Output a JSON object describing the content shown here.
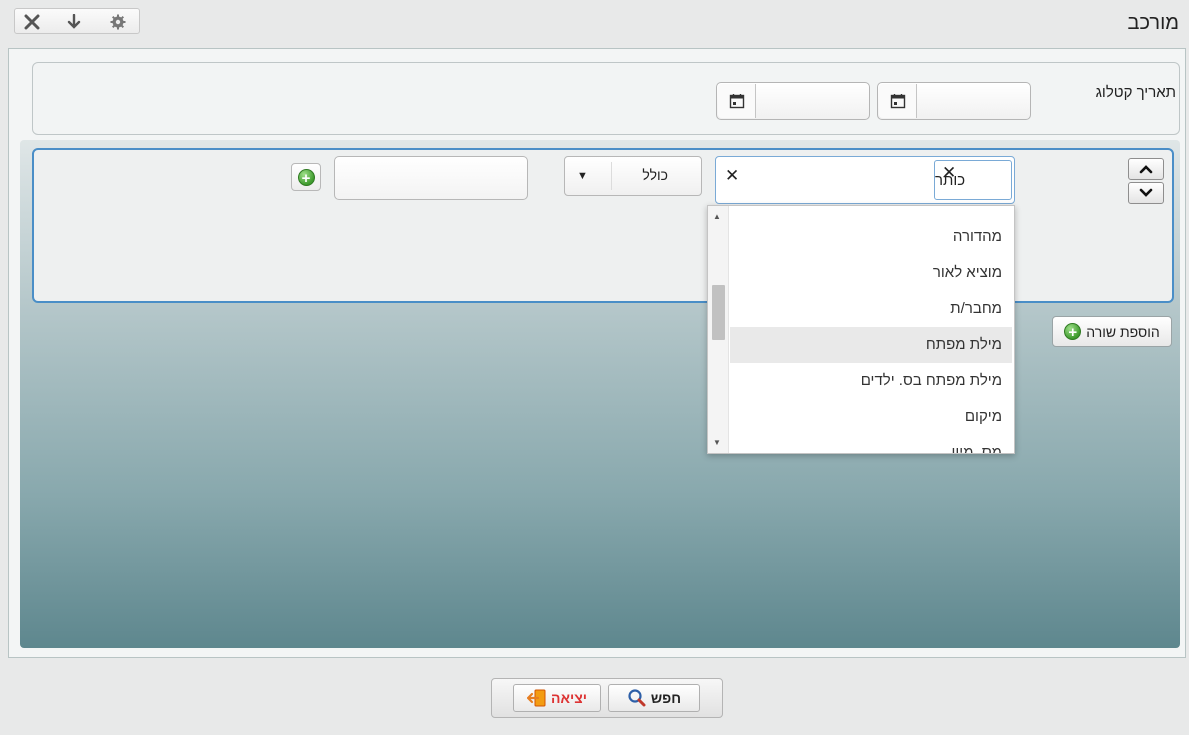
{
  "window": {
    "title": "מורכב",
    "toolbar_icons": [
      "close-icon",
      "download-icon",
      "gear-icon"
    ]
  },
  "date_filter": {
    "label": "תאריך קטלוג",
    "from_value": "",
    "to_value": ""
  },
  "condition": {
    "field_chip": "כותר",
    "operator": "כולל",
    "value": ""
  },
  "dropdown": {
    "items": [
      "מהדורה",
      "מוציא לאור",
      "מחבר/ת",
      "מילת מפתח",
      "מילת מפתח בס. ילדים",
      "מיקום",
      "מס. מיון"
    ],
    "highlighted_index": 3
  },
  "add_row_label": "הוספת שורה",
  "buttons": {
    "search_label": "חפש",
    "exit_label": "יציאה"
  },
  "colors": {
    "panel_border": "#4a8ec7",
    "gradient_bottom": "#5e878e",
    "exit_text": "#dd3333"
  }
}
